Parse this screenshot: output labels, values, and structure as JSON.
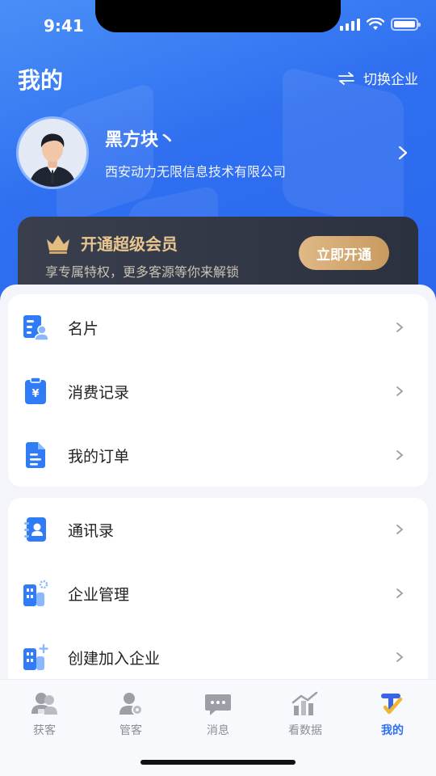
{
  "status": {
    "time": "9:41"
  },
  "header": {
    "title": "我的",
    "switch_label": "切换企业"
  },
  "profile": {
    "name": "黑方块丶",
    "company": "西安动力无限信息技术有限公司"
  },
  "vip": {
    "title": "开通超级会员",
    "subtitle": "享专属特权，更多客源等你来解锁",
    "button": "立即开通",
    "accent": "#e8c68f"
  },
  "menu_group_1": [
    {
      "label": "名片",
      "icon": "business-card-icon"
    },
    {
      "label": "消费记录",
      "icon": "receipt-icon"
    },
    {
      "label": "我的订单",
      "icon": "document-icon"
    }
  ],
  "menu_group_2": [
    {
      "label": "通讯录",
      "icon": "contacts-icon"
    },
    {
      "label": "企业管理",
      "icon": "building-settings-icon"
    },
    {
      "label": "创建加入企业",
      "icon": "building-add-icon"
    }
  ],
  "tabbar": [
    {
      "label": "获客",
      "icon": "users-icon",
      "active": false
    },
    {
      "label": "管客",
      "icon": "user-manage-icon",
      "active": false
    },
    {
      "label": "消息",
      "icon": "message-icon",
      "active": false
    },
    {
      "label": "看数据",
      "icon": "chart-icon",
      "active": false
    },
    {
      "label": "我的",
      "icon": "me-icon",
      "active": true
    }
  ],
  "colors": {
    "primary": "#2f6ff0",
    "icon_blue": "#2f7cf6"
  }
}
